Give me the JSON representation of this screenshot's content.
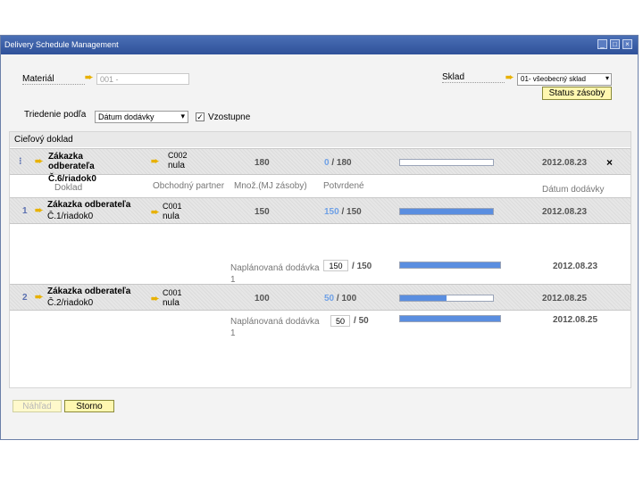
{
  "window": {
    "title": "Delivery Schedule Management"
  },
  "header": {
    "material_label": "Materiál",
    "material_value": "001 -",
    "warehouse_label": "Sklad",
    "warehouse_value": "01- všeobecný sklad",
    "stock_status_button": "Status zásoby",
    "sort_label": "Triedenie podľa",
    "sort_value": "Dátum dodávky",
    "ascending_label": "Vzostupne",
    "ascending_checked": true
  },
  "grid": {
    "section_title": "Cieľový doklad",
    "parent": {
      "doc_title": "Zákazka odberateľa",
      "doc_ref": "Č.6/riadok0",
      "bp_code": "C002",
      "bp_name": "nula",
      "qty": "180",
      "confirmed": "0",
      "total": "180",
      "confirmed_fraction": 0.0,
      "date": "2012.08.23"
    },
    "columns": [
      "Doklad",
      "Obchodný partner",
      "Množ.(MJ zásoby)",
      "Potvrdené",
      "Dátum dodávky"
    ],
    "children": [
      {
        "index": "1",
        "doc_title": "Zákazka odberateľa",
        "doc_ref": "Č.1/riadok0",
        "bp_code": "C001",
        "bp_name": "nula",
        "qty": "150",
        "confirmed": "150",
        "total": "150",
        "confirmed_fraction": 1.0,
        "date": "2012.08.23",
        "planned_label": "Naplánovaná dodávka",
        "planned_index": "1",
        "planned_qty": "150",
        "planned_total": "150",
        "planned_fraction": 1.0,
        "planned_date": "2012.08.23"
      },
      {
        "index": "2",
        "doc_title": "Zákazka odberateľa",
        "doc_ref": "Č.2/riadok0",
        "bp_code": "C001",
        "bp_name": "nula",
        "qty": "100",
        "confirmed": "50",
        "total": "100",
        "confirmed_fraction": 0.5,
        "date": "2012.08.25",
        "planned_label": "Naplánovaná dodávka",
        "planned_index": "1",
        "planned_qty": "50",
        "planned_total": "50",
        "planned_fraction": 1.0,
        "planned_date": "2012.08.25"
      }
    ]
  },
  "footer": {
    "preview_button": "Náhľad",
    "cancel_button": "Storno"
  },
  "colors": {
    "title_bar": "#2f5199",
    "button_yellow": "#fff7b0",
    "progress_fill": "#5a8ee0",
    "confirmed_blue": "#6ea0e6"
  }
}
